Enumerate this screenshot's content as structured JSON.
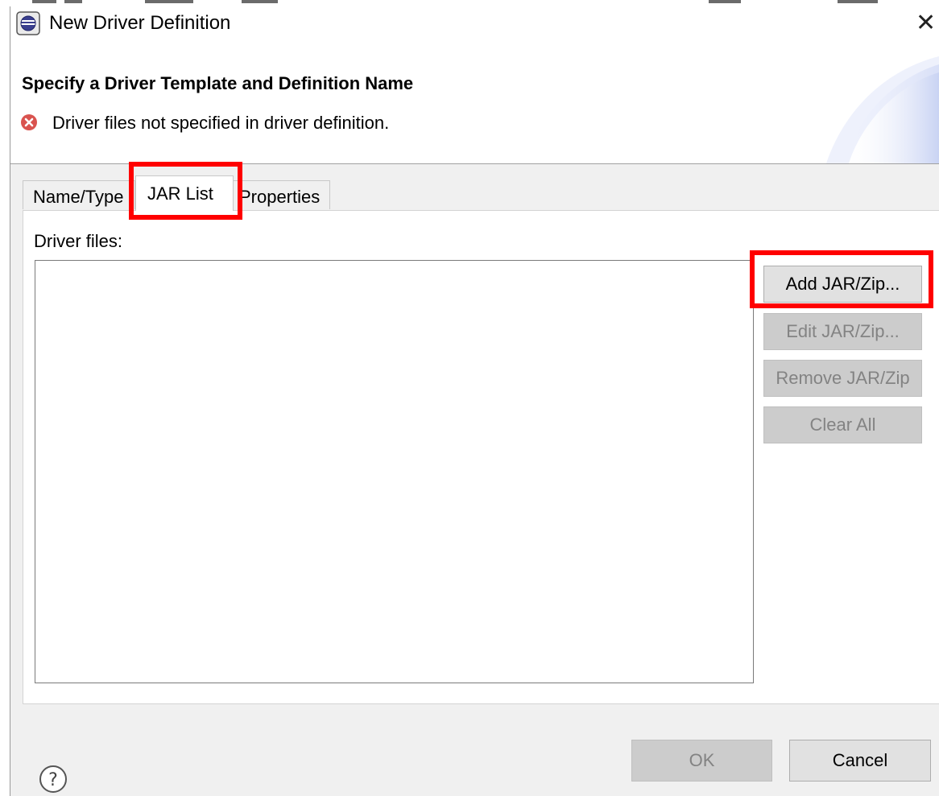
{
  "window": {
    "title": "New Driver Definition",
    "close_glyph": "✕",
    "icon": "eclipse-datasource-icon"
  },
  "banner": {
    "title": "Specify a Driver Template and Definition Name",
    "error_icon": "error-icon",
    "error_message": "Driver files not specified in driver definition."
  },
  "tabs": [
    {
      "label": "Name/Type",
      "selected": false
    },
    {
      "label": "JAR List",
      "selected": true
    },
    {
      "label": "Properties",
      "selected": false
    }
  ],
  "jar_list": {
    "label": "Driver files:",
    "files": [],
    "buttons": {
      "add": {
        "label": "Add JAR/Zip...",
        "enabled": true
      },
      "edit": {
        "label": "Edit JAR/Zip...",
        "enabled": false
      },
      "remove": {
        "label": "Remove JAR/Zip",
        "enabled": false
      },
      "clear": {
        "label": "Clear All",
        "enabled": false
      }
    }
  },
  "footer": {
    "help_glyph": "?",
    "ok_label": "OK",
    "ok_enabled": false,
    "cancel_label": "Cancel"
  },
  "colors": {
    "highlight": "#ff0000",
    "error": "#d9534f",
    "dialog_bg": "#f0f0f0",
    "disabled_button_bg": "#cccccc",
    "disabled_text": "#838383"
  }
}
